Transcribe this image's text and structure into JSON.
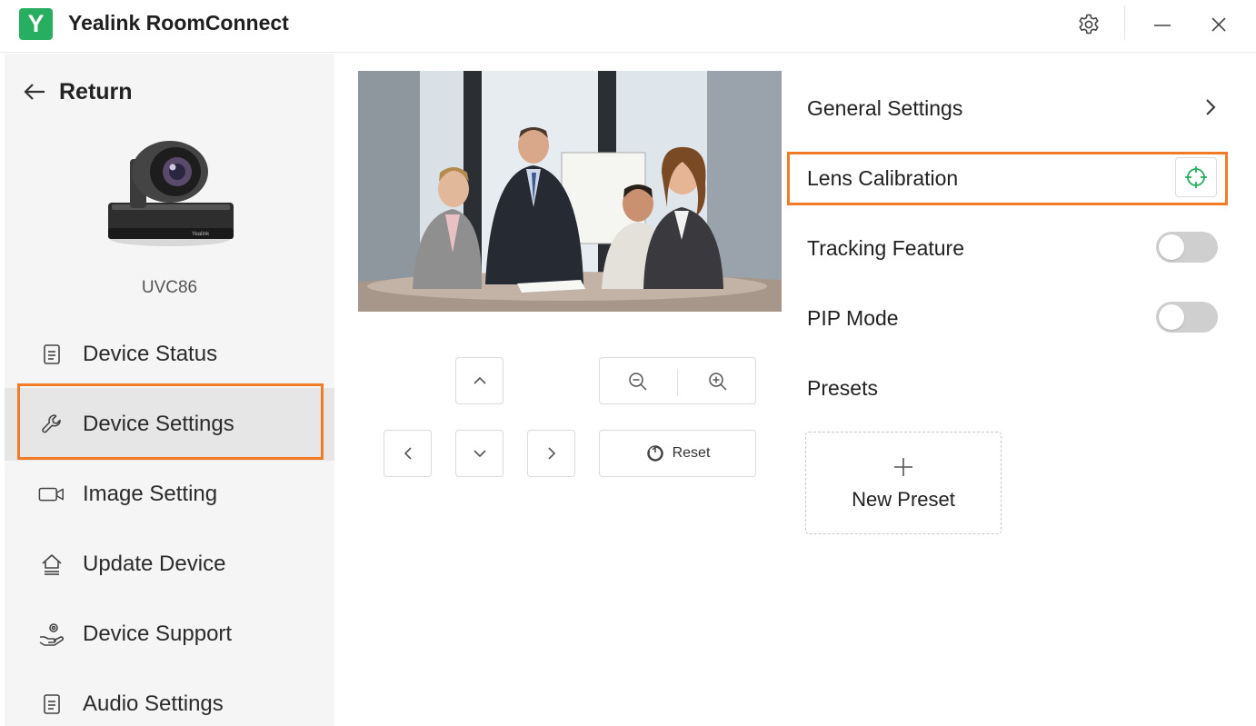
{
  "app": {
    "logo_letter": "Y",
    "title": "Yealink RoomConnect"
  },
  "titlebar": {
    "icons": [
      "gear-icon",
      "minimize-icon",
      "close-icon"
    ]
  },
  "sidebar": {
    "return_label": "Return",
    "device_name": "UVC86",
    "items": [
      {
        "label": "Device Status",
        "icon": "document-icon"
      },
      {
        "label": "Device Settings",
        "icon": "wrench-icon",
        "active": true
      },
      {
        "label": "Image Setting",
        "icon": "video-camera-icon"
      },
      {
        "label": "Update Device",
        "icon": "upload-home-icon"
      },
      {
        "label": "Device Support",
        "icon": "support-hand-icon"
      },
      {
        "label": "Audio Settings",
        "icon": "document-icon"
      }
    ]
  },
  "camera_controls": {
    "reset_label": "Reset"
  },
  "settings": {
    "general_label": "General Settings",
    "lens_label": "Lens Calibration",
    "tracking_label": "Tracking Feature",
    "tracking_on": false,
    "pip_label": "PIP Mode",
    "pip_on": false,
    "presets_label": "Presets",
    "new_preset_label": "New Preset"
  },
  "colors": {
    "accent": "#27ae60",
    "highlight": "#f27b26",
    "toggle_off": "#cfcfcf",
    "sidebar_bg": "#f5f5f5"
  }
}
